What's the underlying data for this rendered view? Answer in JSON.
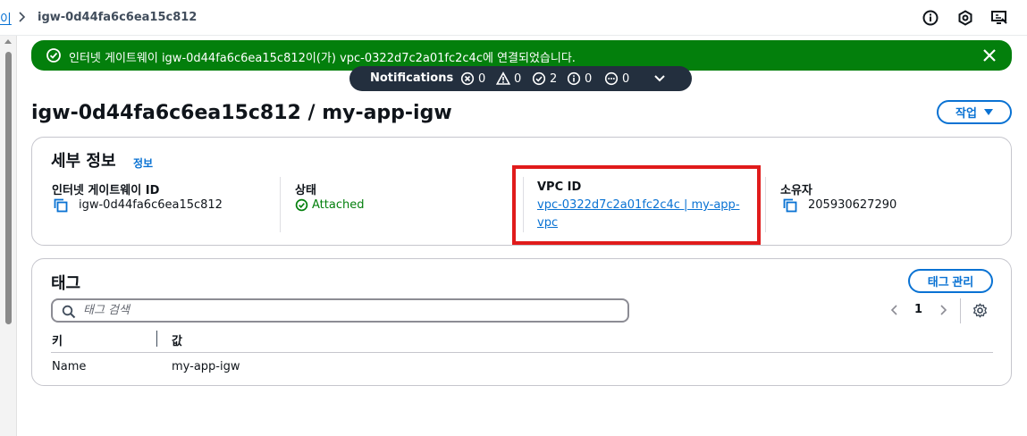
{
  "breadcrumb": {
    "prev": "이",
    "current": "igw-0d44fa6c6ea15c812"
  },
  "top_icons": [
    "info-icon",
    "settings-hex-icon",
    "screen-icon"
  ],
  "flash": {
    "message": "인터넷 게이트웨이 igw-0d44fa6c6ea15c812이(가) vpc-0322d7c2a01fc2c4c에 연결되었습니다.",
    "color": "#037f0c"
  },
  "notifications": {
    "title": "Notifications",
    "errors": "0",
    "warnings": "0",
    "success": "2",
    "info": "0",
    "in_progress": "0"
  },
  "page": {
    "title": "igw-0d44fa6c6ea15c812 / my-app-igw",
    "actions_label": "작업"
  },
  "details": {
    "heading": "세부 정보",
    "info_link": "정보",
    "igw_id_label": "인터넷 게이트웨이 ID",
    "igw_id_value": "igw-0d44fa6c6ea15c812",
    "state_label": "상태",
    "state_value": "Attached",
    "vpc_id_label": "VPC ID",
    "vpc_id_value": "vpc-0322d7c2a01fc2c4c | my-app-vpc",
    "owner_label": "소유자",
    "owner_value": "205930627290"
  },
  "tags": {
    "heading": "태그",
    "manage_label": "태그 관리",
    "search_placeholder": "태그 검색",
    "page_number": "1",
    "columns": [
      "키",
      "값"
    ],
    "rows": [
      {
        "key": "Name",
        "value": "my-app-igw"
      }
    ]
  },
  "colors": {
    "accent": "#0972d3",
    "success": "#037f0c",
    "highlight": "#e01b1b",
    "notification_bg": "#232f3e"
  }
}
